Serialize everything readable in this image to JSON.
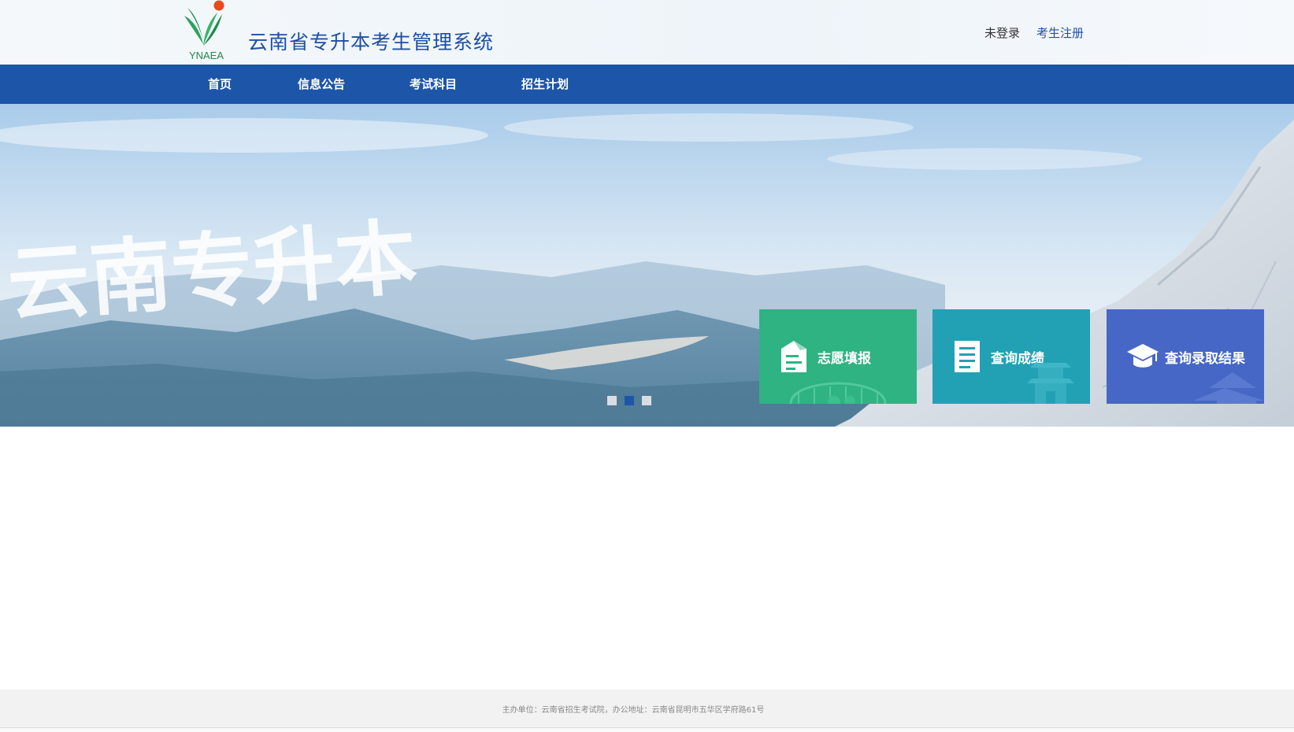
{
  "header": {
    "logo_text": "YNAEA",
    "title": "云南省专升本考生管理系统",
    "login_status": "未登录",
    "register_link": "考生注册"
  },
  "nav": {
    "items": [
      {
        "label": "首页"
      },
      {
        "label": "信息公告"
      },
      {
        "label": "考试科目"
      },
      {
        "label": "招生计划"
      }
    ]
  },
  "banner": {
    "calligraphy": "云南专升本",
    "slides_count": 3,
    "active_slide": 2
  },
  "quick_cards": [
    {
      "label": "志愿填报",
      "icon": "form-icon",
      "color": "#2fb383"
    },
    {
      "label": "查询成绩",
      "icon": "document-list-icon",
      "color": "#22a1b5"
    },
    {
      "label": "查询录取结果",
      "icon": "graduation-cap-icon",
      "color": "#4667c6"
    }
  ],
  "footer": {
    "text": "主办单位：云南省招生考试院，办公地址：云南省昆明市五华区学府路61号"
  },
  "colors": {
    "brand_blue": "#1d56a8",
    "title_blue": "#1f4fa6",
    "dot_active": "#1d56a8",
    "dot_inactive": "#d9dde2"
  }
}
